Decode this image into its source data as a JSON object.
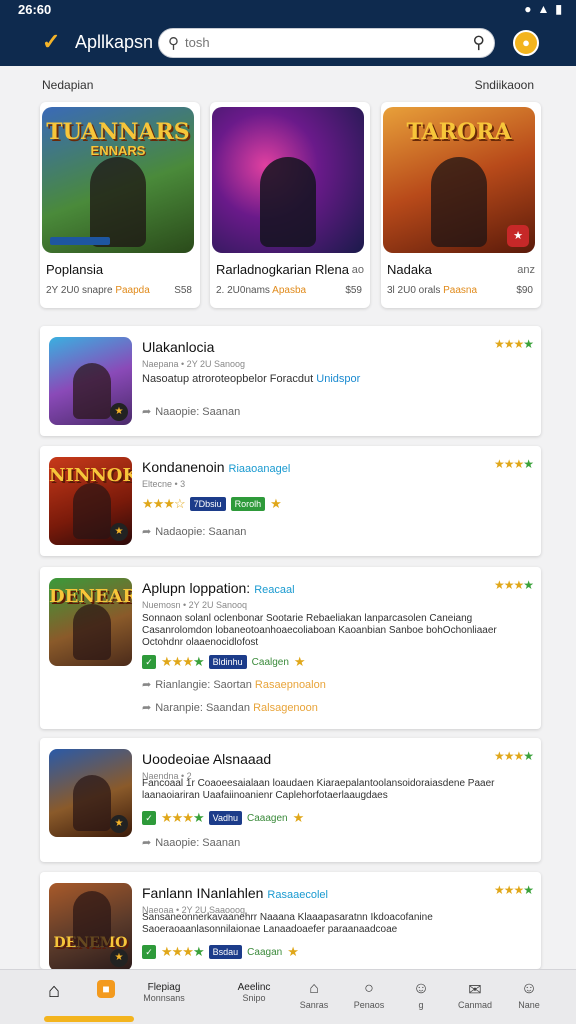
{
  "status": {
    "time": "26:60",
    "icons": [
      "wifi-icon",
      "signal-icon",
      "battery-icon"
    ]
  },
  "header": {
    "app_title": "Apllkapsn",
    "search_placeholder": "tosh"
  },
  "section": {
    "left": "Nedapian",
    "right": "Sndiikaoon"
  },
  "featured": [
    {
      "art_title": "TUANNARS",
      "art_sub": "ENNARS",
      "name": "Poplansia",
      "name2": "",
      "meta": "2Y 2U0 snapre",
      "meta_hl": "Paapda",
      "price": "S58",
      "bg": "linear-gradient(160deg,#3a6ab8 0%,#4a8a3a 55%,#2a4a1a 100%)"
    },
    {
      "art_title": "",
      "art_sub": "",
      "name": "Rarladnogkarian Rlena",
      "name2": "ao",
      "meta": "2. 2U0nams",
      "meta_hl": "Apasba",
      "price": "$59",
      "bg": "radial-gradient(circle at 35% 40%,#e040a0 0%,#6a1a8a 40%,#1a1a4a 100%)"
    },
    {
      "art_title": "TARORA",
      "art_sub": "",
      "name": "Nadaka",
      "name2": "anz",
      "meta": "3l 2U0 orals",
      "meta_hl": "Paasna",
      "price": "$90",
      "bg": "linear-gradient(160deg,#e8a03a 0%,#b84a1a 50%,#5a1a0a 100%)"
    }
  ],
  "list": [
    {
      "title": "Ulakanlocia",
      "tag": "",
      "sub": "Naepana • 2Y 2U Sanoog",
      "sub_hl": "",
      "desc": "Nasoatup atroroteopbelor Foracdut",
      "desc_link": "Unidspor",
      "chip1": "",
      "chip2": "",
      "chip_label": "",
      "action1": "Naaopie: Saanan",
      "action1_hl": "",
      "action2": "",
      "action2_hl": "",
      "thumb_title": "",
      "thumb_bg": "linear-gradient(160deg,#3ab0e0 0%,#8a4ab8 50%,#4a2a6a 100%)"
    },
    {
      "title": "Kondanenoin",
      "tag": "Riaaoanagel",
      "sub": "Eltecne • 3",
      "sub_hl": "",
      "desc": "",
      "desc_link": "",
      "chip1": "7Dbsiu",
      "chip2": "Rorolh",
      "chip_label": "",
      "action1": "Nadaopie: Saanan",
      "action1_hl": "",
      "action2": "",
      "action2_hl": "",
      "thumb_title": "NINNOK",
      "thumb_bg": "linear-gradient(160deg,#c83a1a 0%,#7a1a0a 60%,#2a0a0a 100%)"
    },
    {
      "title": "Aplupn loppation:",
      "tag": "Reacaal",
      "sub": "Nuemosn • 2Y 2U Sanooq",
      "sub_hl": "",
      "desc": "Sonnaon solanl oclenbonar Sootarie Rebaeliakan lanparcasolen Caneiang Casanrolomdon lobaneotoanhoaecoliaboan Kaoanbian Sanboe bohOchonliaaer Octohdnr olaaenocidlofost",
      "desc_link": "",
      "chip1": "Bldinhu",
      "chip2": "",
      "chip_label": "Caalgen",
      "action1": "Rianlangie: Saortan",
      "action1_hl": "Rasaepnoalon",
      "action2": "Naranpie: Saandan",
      "action2_hl": "Ralsagenoon",
      "thumb_title": "DENEAR",
      "thumb_bg": "linear-gradient(160deg,#3a9a3a 0%,#8a5a2a 55%,#4a2a1a 100%)"
    },
    {
      "title": "Uoodeoiae Alsnaaad",
      "tag": "",
      "sub": "Naendna • 2",
      "sub_hl": "",
      "desc": "Fancoaal 1r Coaoeesaialaan loaudaen Kiaraepalantoolansoidoraiasdene Paaer laanaoiariran Uaafaiinoanienr Caplehorfotaerlaaugdaes",
      "desc_link": "",
      "chip1": "Vadhu",
      "chip2": "",
      "chip_label": "Caaagen",
      "action1": "Naaopie: Saanan",
      "action1_hl": "",
      "action2": "",
      "action2_hl": "",
      "thumb_title": "",
      "thumb_bg": "linear-gradient(160deg,#2a5aa8 0%,#8a5a2a 55%,#3a1a0a 100%)"
    },
    {
      "title": "Fanlann INanlahlen",
      "tag": "Rasaaecolel",
      "sub": "Naeoaa • 2Y 2U Saaooog",
      "sub_hl": "",
      "desc": "Sansaneonnerkavaanehrr Naaana Klaaapasaratnn Ikdoacofanine Saoeraoaanlasonnilaionae Lanaadoaefer paraanaadcoae",
      "desc_link": "",
      "chip1": "Bsdau",
      "chip2": "",
      "chip_label": "Caagan",
      "action1": "",
      "action1_hl": "",
      "action2": "",
      "action2_hl": "",
      "thumb_title": "DENEMO",
      "thumb_bg": "linear-gradient(160deg,#a85a2a 0%,#5a3a2a 55%,#2a1a1a 100%)"
    }
  ],
  "nav": [
    {
      "icon": "⌂",
      "label": "",
      "sub": ""
    },
    {
      "icon": "▣",
      "label": "",
      "sub": ""
    },
    {
      "icon": "",
      "label": "Flepiag",
      "sub": "Monnsans"
    },
    {
      "icon": "",
      "label": "Aeelinc",
      "sub": "Snipo"
    },
    {
      "icon": "⌂",
      "label": "",
      "sub": "Sanras"
    },
    {
      "icon": "○",
      "label": "",
      "sub": "Penaos"
    },
    {
      "icon": "☺",
      "label": "",
      "sub": "g"
    },
    {
      "icon": "✉",
      "label": "",
      "sub": "Canmad"
    },
    {
      "icon": "⚐",
      "label": "",
      "sub": "Nane"
    }
  ],
  "colors": {
    "header_bg": "#0e2a4e",
    "accent": "#f5b428",
    "star": "#e0a71a"
  }
}
